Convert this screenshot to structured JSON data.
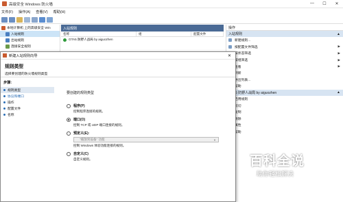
{
  "window": {
    "title": "高级安全 Windows 防火墙",
    "min": "—",
    "max": "☐",
    "close": "✕"
  },
  "menu": [
    "文件(F)",
    "操作(A)",
    "查看(V)",
    "帮助(H)"
  ],
  "tree": [
    {
      "label": "本地计算机 上的高级安全 Win",
      "selected": false
    },
    {
      "label": "入站规则",
      "selected": true
    },
    {
      "label": "出站规则",
      "selected": false
    },
    {
      "label": "连接安全规则",
      "selected": false
    }
  ],
  "center": {
    "header": "入站规则",
    "columns": [
      "名称",
      "组",
      "配置文件"
    ],
    "rows": [
      "GTA5 防野人战局 by aiguozhen"
    ]
  },
  "actions": {
    "section1_title": "操作",
    "section1_header": "入站规则",
    "items": [
      {
        "label": "新建规则...",
        "arrow": false
      },
      {
        "label": "按配置文件筛选",
        "arrow": true
      },
      {
        "label": "按状态筛选",
        "arrow": true
      },
      {
        "label": "按组筛选",
        "arrow": true
      },
      {
        "label": "查看",
        "arrow": true
      },
      {
        "label": "刷新",
        "arrow": false
      },
      {
        "label": "导出列表...",
        "arrow": false
      },
      {
        "label": "帮助",
        "arrow": false
      }
    ],
    "section2_header": "GTA5 防野人战局 by aiguozhen",
    "items2": [
      {
        "label": "启用规则"
      },
      {
        "label": "剪切"
      },
      {
        "label": "复制"
      },
      {
        "label": "删除"
      },
      {
        "label": "属性"
      },
      {
        "label": "帮助"
      }
    ]
  },
  "dialog": {
    "title": "新建入站规则向导",
    "close": "✕",
    "heading": "规则类型",
    "subheading": "选择要创建的防火墙规则类型",
    "steps_label": "步骤:",
    "steps": [
      {
        "label": "规则类型",
        "active": true,
        "link": false
      },
      {
        "label": "协议和端口",
        "active": false,
        "link": true
      },
      {
        "label": "操作",
        "active": false,
        "link": false
      },
      {
        "label": "配置文件",
        "active": false,
        "link": false
      },
      {
        "label": "名称",
        "active": false,
        "link": false
      }
    ],
    "question": "要创建的规则类型",
    "options": [
      {
        "label": "程序(P)",
        "desc": "控制程序连接的规则。",
        "checked": false
      },
      {
        "label": "端口(O)",
        "desc": "控制 TCP 或 UDP 端口连接的规则。",
        "checked": true
      },
      {
        "label": "预定义(E):",
        "desc": "控制 Windows 体验功能连接的规则。",
        "checked": false
      },
      {
        "label": "自定义(C)",
        "desc": "自定义规则。",
        "checked": false
      }
    ],
    "predefined_value": "\"播放到设备\" 功能"
  },
  "watermark": {
    "main": "百科全说",
    "sub": "助你轻松解决"
  }
}
